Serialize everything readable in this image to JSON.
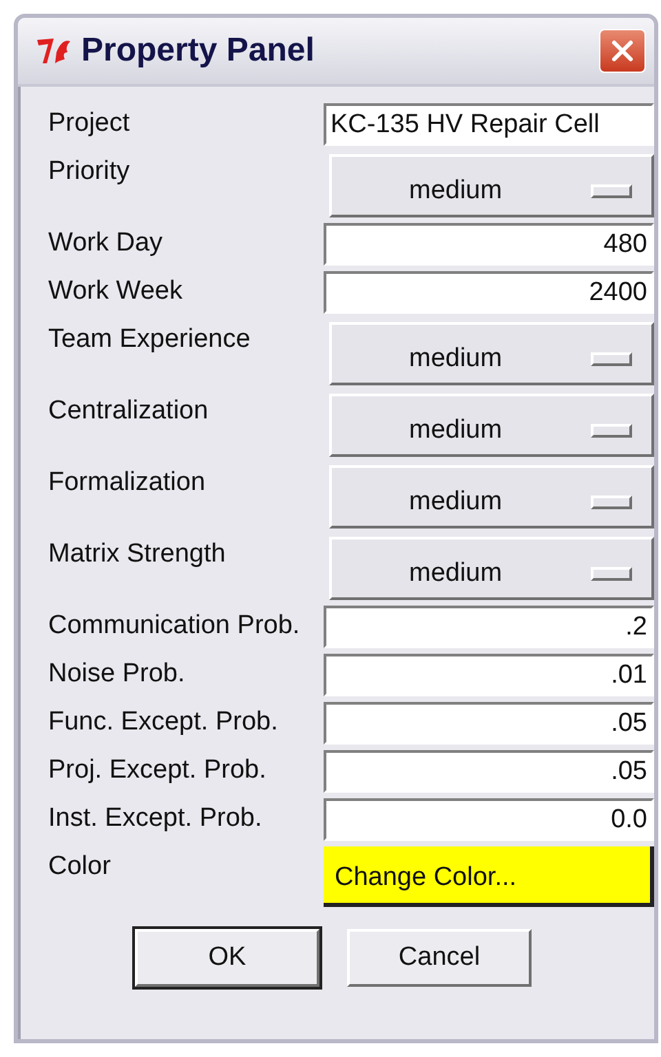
{
  "window": {
    "title": "Property Panel"
  },
  "fields": [
    {
      "label": "Project",
      "kind": "text",
      "value": "KC-135 HV Repair Cell"
    },
    {
      "label": "Priority",
      "kind": "menu",
      "value": "medium"
    },
    {
      "label": "Work Day",
      "kind": "number",
      "value": "480"
    },
    {
      "label": "Work Week",
      "kind": "number",
      "value": "2400"
    },
    {
      "label": "Team Experience",
      "kind": "menu",
      "value": "medium"
    },
    {
      "label": "Centralization",
      "kind": "menu",
      "value": "medium"
    },
    {
      "label": "Formalization",
      "kind": "menu",
      "value": "medium"
    },
    {
      "label": "Matrix Strength",
      "kind": "menu",
      "value": "medium"
    },
    {
      "label": "Communication Prob.",
      "kind": "number",
      "value": ".2"
    },
    {
      "label": "Noise Prob.",
      "kind": "number",
      "value": ".01"
    },
    {
      "label": "Func. Except. Prob.",
      "kind": "number",
      "value": ".05"
    },
    {
      "label": "Proj. Except. Prob.",
      "kind": "number",
      "value": ".05"
    },
    {
      "label": "Inst. Except. Prob.",
      "kind": "number",
      "value": "0.0"
    },
    {
      "label": "Color",
      "kind": "color",
      "value": "Change Color...",
      "color": "#ffff00"
    }
  ],
  "buttons": [
    {
      "label": "OK",
      "default": true
    },
    {
      "label": "Cancel",
      "default": false
    }
  ]
}
